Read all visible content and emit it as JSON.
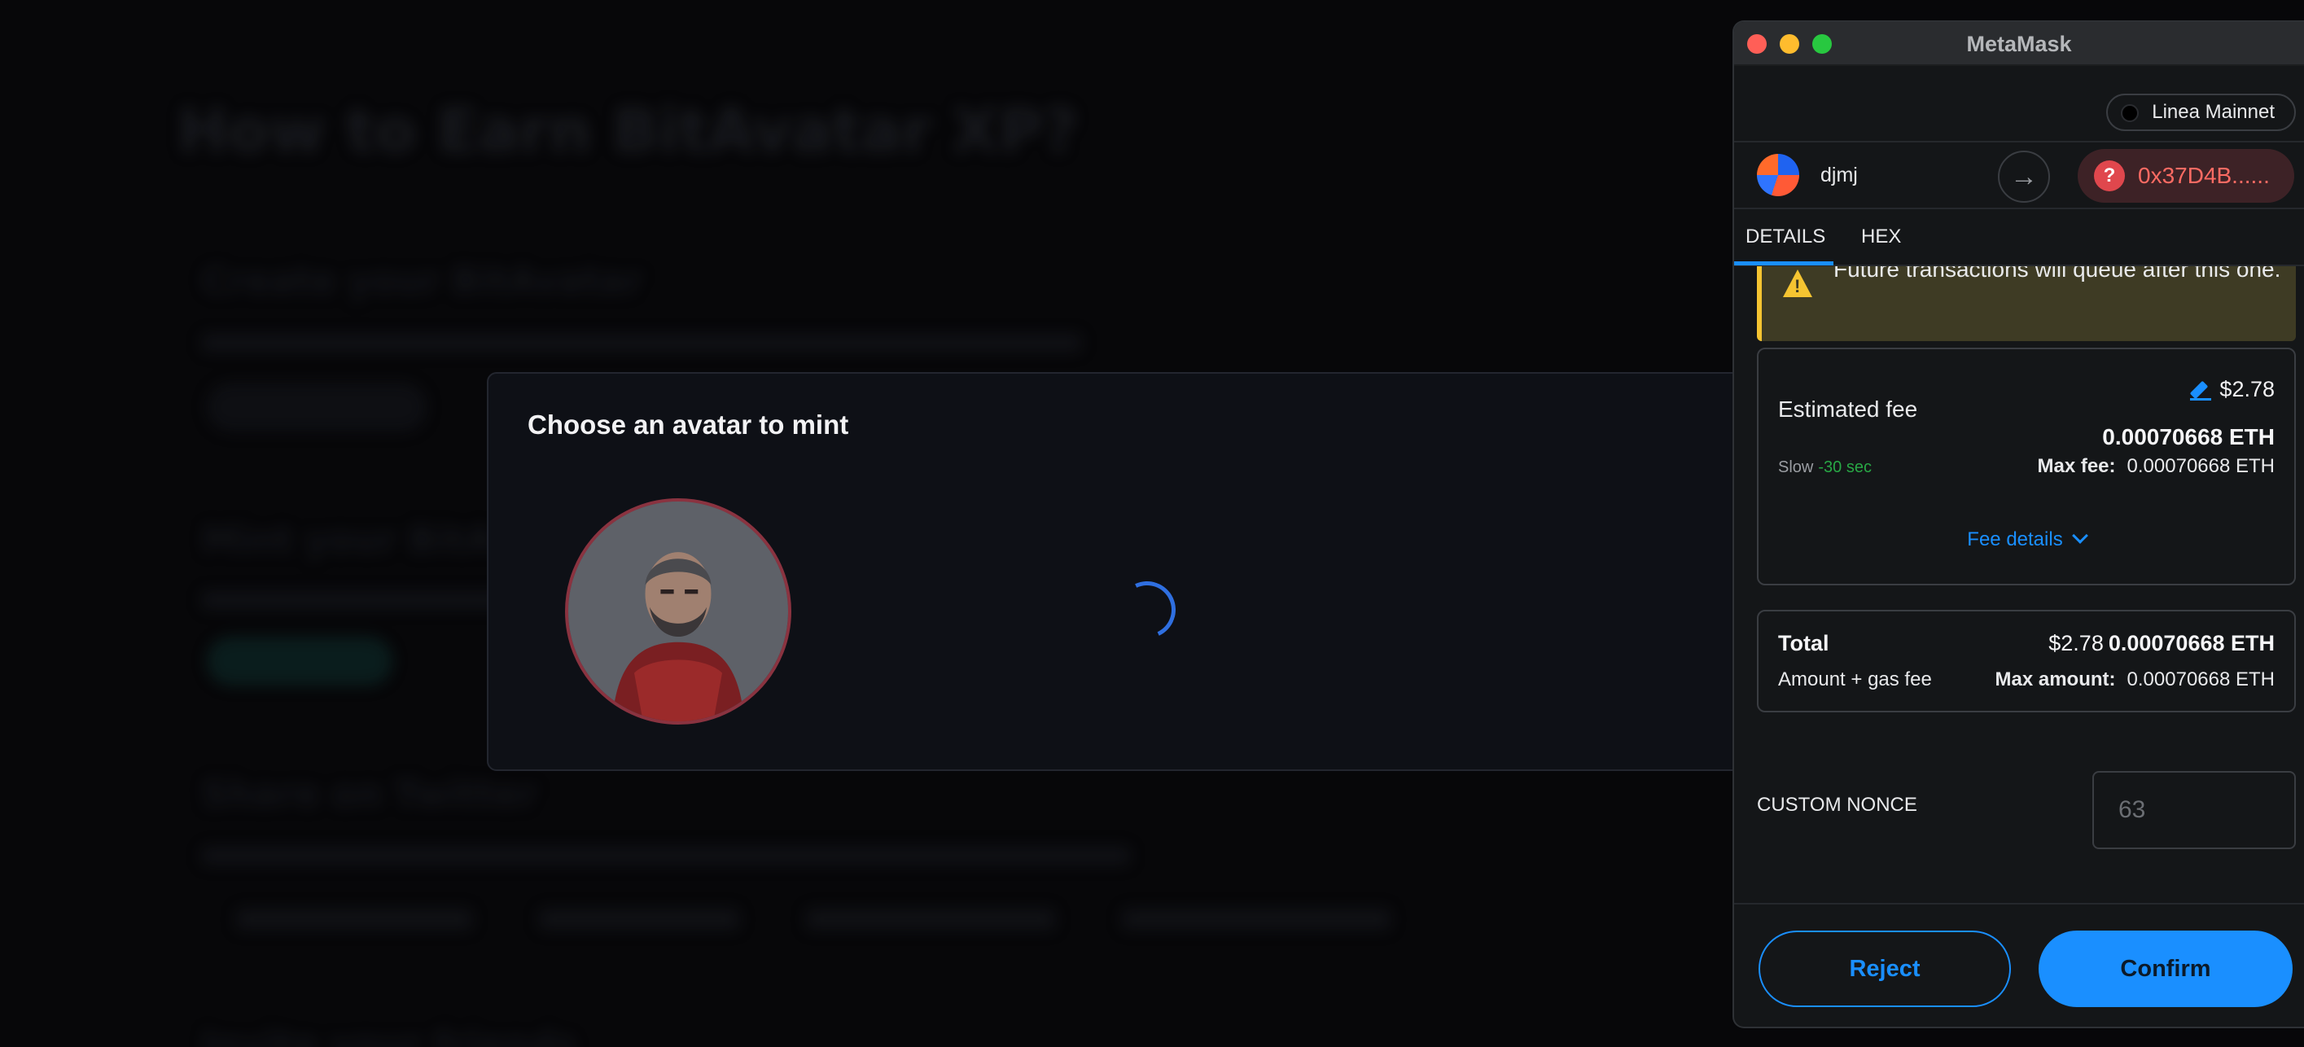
{
  "background_page": {
    "heading": "How to Earn BitAvatar XP?",
    "section_1": "Create your BitAvatar",
    "section_2": "Mint your BitAvatar",
    "section_3": "Share on Twitter",
    "section_4": "Invite your friends"
  },
  "mint_modal": {
    "title": "Choose an avatar to mint",
    "avatar_icon": "warrior-portrait",
    "loading_icon": "spinner"
  },
  "metamask": {
    "window_title": "MetaMask",
    "network": "Linea Mainnet",
    "account_name": "djmj",
    "to_address": "0x37D4B......",
    "tabs": [
      "DETAILS",
      "HEX"
    ],
    "warning_text": "Future transactions will queue after this one.",
    "fee": {
      "label": "Estimated fee",
      "usd": "$2.78",
      "eth": "0.00070668 ETH",
      "speed": "Slow",
      "time": "-30 sec",
      "max_fee_label": "Max fee:",
      "max_fee_value": "0.00070668 ETH",
      "details_link": "Fee details"
    },
    "total": {
      "label": "Total",
      "sub_label": "Amount + gas fee",
      "usd": "$2.78",
      "eth": "0.00070668 ETH",
      "max_amount_label": "Max amount:",
      "max_amount_value": "0.00070668 ETH"
    },
    "nonce": {
      "label": "CUSTOM NONCE",
      "placeholder": "63"
    },
    "buttons": {
      "reject": "Reject",
      "confirm": "Confirm"
    },
    "colors": {
      "accent": "#1a8fff",
      "warning": "#f5c431",
      "danger": "#ff6b63",
      "success": "#28a745"
    }
  }
}
